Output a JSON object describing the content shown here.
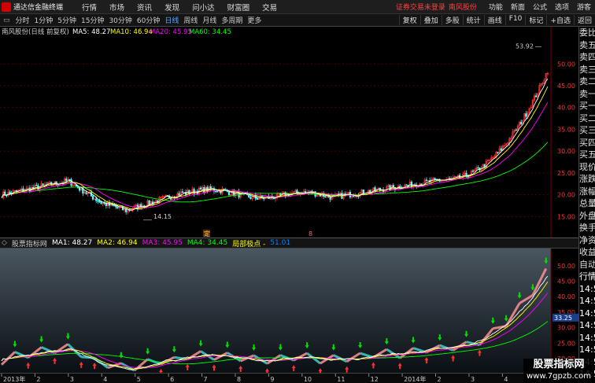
{
  "titlebar": {
    "app_name": "通达信金融终端",
    "menus": [
      "行情",
      "市场",
      "资讯",
      "发现",
      "问小达",
      "财富圈",
      "交易"
    ],
    "notice": "证券交易未登录",
    "stock": "南风股份",
    "right_menus": [
      "功能",
      "新面",
      "公式",
      "选项",
      "游客"
    ]
  },
  "toolbar": {
    "periods": [
      "分时",
      "1分钟",
      "5分钟",
      "15分钟",
      "30分钟",
      "60分钟",
      "日线",
      "周线",
      "月线",
      "多周期",
      "更多"
    ],
    "active_period": "日线",
    "right_buttons": [
      "复权",
      "叠加",
      "多股",
      "统计",
      "画线",
      "F10",
      "标记",
      "+自选",
      "返回"
    ]
  },
  "main_legend": {
    "title": "南风股份(日线 前复权)",
    "ma5": "MA5: 48.27",
    "ma10": "MA10: 46.94",
    "ma20": "MA20: 45.95",
    "ma60": "MA60: 34.45"
  },
  "main_annotations": {
    "high_label": "53.92",
    "low_label": "14.15",
    "marker1": "定",
    "marker2": "8"
  },
  "sub_legend": {
    "title": "股票指标网",
    "ma1": "MA1: 48.27",
    "ma2": "MA2: 46.94",
    "ma3": "MA3: 45.95",
    "ma4": "MA4: 34.45",
    "extra": "局部极点 -",
    "extra_val": "51.01"
  },
  "main_axis": [
    "50.00",
    "45.00",
    "40.00",
    "35.00",
    "30.00",
    "25.00",
    "20.00",
    "15.00"
  ],
  "sub_axis": [
    "50.00",
    "45.00",
    "40.00",
    "35.00",
    "30.00",
    "25.00",
    "20.00"
  ],
  "sub_cursor_label": "33.25",
  "date_labels": [
    "2013年",
    "2",
    "3",
    "4",
    "5",
    "6",
    "7",
    "8",
    "9",
    "10",
    "11",
    "12",
    "2014年",
    "2",
    "3",
    "4",
    "5"
  ],
  "side_panel": [
    "委比",
    "卖五",
    "卖四",
    "卖三",
    "卖二",
    "卖一",
    "买一",
    "买二",
    "买三",
    "买四",
    "买五",
    "现价",
    "涨跌",
    "涨幅",
    "总量",
    "外盘",
    "换手",
    "净资",
    "收益",
    "自动",
    "行情",
    "14:56",
    "14:56",
    "14:56",
    "14:56",
    "14:56",
    "14:56",
    "14:56",
    "14:56"
  ],
  "watermark": {
    "line1": "股票指标网",
    "line2": "www.7gpzb.com"
  },
  "colors": {
    "up": "#ff3232",
    "down": "#54ffff",
    "ma5": "#ffffff",
    "ma10": "#ffff00",
    "ma20": "#ff00ff",
    "ma60": "#00ff00",
    "axis_text": "#ff3232"
  }
}
